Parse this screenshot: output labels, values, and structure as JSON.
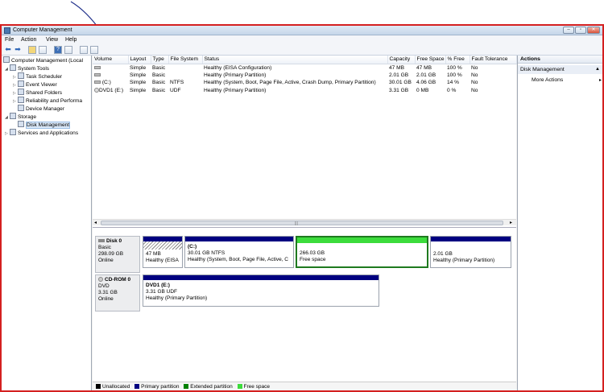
{
  "window": {
    "title": "Computer Management"
  },
  "menu": [
    "File",
    "Action",
    "View",
    "Help"
  ],
  "tree": {
    "root": "Computer Management (Local",
    "items": [
      {
        "label": "System Tools",
        "level": 1
      },
      {
        "label": "Task Scheduler",
        "level": 2
      },
      {
        "label": "Event Viewer",
        "level": 2
      },
      {
        "label": "Shared Folders",
        "level": 2
      },
      {
        "label": "Reliability and Performa",
        "level": 2
      },
      {
        "label": "Device Manager",
        "level": 2
      },
      {
        "label": "Storage",
        "level": 1
      },
      {
        "label": "Disk Management",
        "level": 2
      },
      {
        "label": "Services and Applications",
        "level": 1
      }
    ]
  },
  "volumes": {
    "columns": [
      "Volume",
      "Layout",
      "Type",
      "File System",
      "Status",
      "Capacity",
      "Free Space",
      "% Free",
      "Fault Tolerance"
    ],
    "rows": [
      [
        "",
        "Simple",
        "Basic",
        "",
        "Healthy (EISA Configuration)",
        "47 MB",
        "47 MB",
        "100 %",
        "No"
      ],
      [
        "",
        "Simple",
        "Basic",
        "",
        "Healthy (Primary Partition)",
        "2.01 GB",
        "2.01 GB",
        "100 %",
        "No"
      ],
      [
        "(C:)",
        "Simple",
        "Basic",
        "NTFS",
        "Healthy (System, Boot, Page File, Active, Crash Dump, Primary Partition)",
        "30.01 GB",
        "4.06 GB",
        "14 %",
        "No"
      ],
      [
        "DVD1 (E:)",
        "Simple",
        "Basic",
        "UDF",
        "Healthy (Primary Partition)",
        "3.31 GB",
        "0 MB",
        "0 %",
        "No"
      ]
    ]
  },
  "disks": {
    "disk0": {
      "name": "Disk 0",
      "type": "Basic",
      "size": "298.09 GB",
      "state": "Online",
      "partitions": [
        {
          "title": "",
          "line1": "47 MB",
          "line2": "Healthy (EISA"
        },
        {
          "title": "(C:)",
          "line1": "30.01 GB NTFS",
          "line2": "Healthy (System, Boot, Page File, Active, C"
        },
        {
          "title": "",
          "line1": "266.03 GB",
          "line2": "Free space"
        },
        {
          "title": "",
          "line1": "2.01 GB",
          "line2": "Healthy (Primary Partition)"
        }
      ]
    },
    "cdrom0": {
      "name": "CD-ROM 0",
      "type": "DVD",
      "size": "3.31 GB",
      "state": "Online",
      "partitions": [
        {
          "title": "DVD1  (E:)",
          "line1": "3.31 GB UDF",
          "line2": "Healthy (Primary Partition)"
        }
      ]
    }
  },
  "legend": [
    {
      "label": "Unallocated",
      "color": "#000000"
    },
    {
      "label": "Primary partition",
      "color": "#000080"
    },
    {
      "label": "Extended partition",
      "color": "#008000"
    },
    {
      "label": "Free space",
      "color": "#3cdc3c"
    }
  ],
  "actions": {
    "header": "Actions",
    "section": "Disk Management",
    "more": "More Actions"
  },
  "colors": {
    "frame_border": "#d42020",
    "primary": "#000080",
    "free": "#3cdc3c",
    "pen": "#1f2f8a"
  }
}
